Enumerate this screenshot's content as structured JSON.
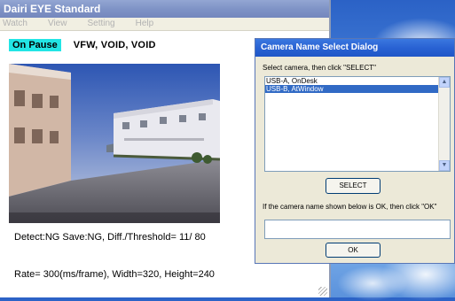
{
  "main_window": {
    "title": "Dairi EYE Standard",
    "menu": [
      "Watch",
      "View",
      "Setting",
      "Help"
    ],
    "status_badge": "On Pause",
    "channels": "VFW,  VOID,  VOID",
    "detect_line": "Detect:NG Save:NG, Diff./Threshold=   11/ 80",
    "rate_line": "Rate= 300(ms/frame), Width=320, Height=240"
  },
  "dialog": {
    "title": "Camera Name Select Dialog",
    "prompt": "Select camera, then click \"SELECT\"",
    "cameras": [
      "USB-A, OnDesk",
      "USB-B, AtWindow"
    ],
    "selected_index": 1,
    "select_label": "SELECT",
    "prompt2": "If the camera name shown below is OK, then click \"OK\"",
    "name_field_value": "",
    "ok_label": "OK"
  },
  "colors": {
    "badge": "#22e5e5",
    "main_title": "#7f93c6",
    "dialog_title": "#2962d3",
    "selection": "#316ac5"
  }
}
